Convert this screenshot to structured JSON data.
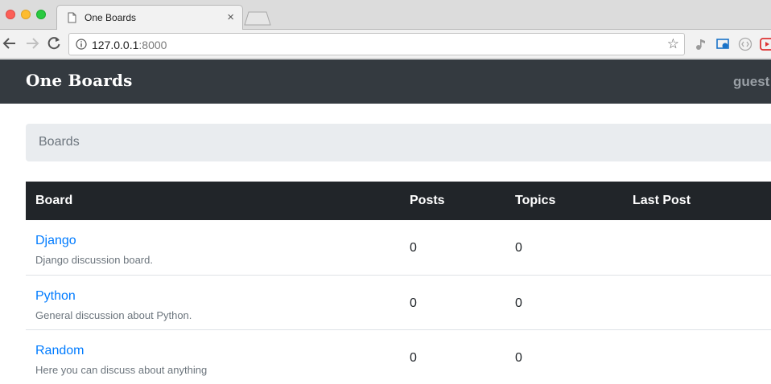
{
  "browser": {
    "tab_title": "One Boards",
    "tab_close": "×",
    "url_host": "127.0.0.1",
    "url_port": ":8000",
    "bookmark_star": "☆"
  },
  "navbar": {
    "brand": "One Boards",
    "user": "guest"
  },
  "breadcrumb": {
    "current": "Boards"
  },
  "table": {
    "headers": [
      "Board",
      "Posts",
      "Topics",
      "Last Post"
    ],
    "rows": [
      {
        "name": "Django",
        "description": "Django discussion board.",
        "posts": "0",
        "topics": "0"
      },
      {
        "name": "Python",
        "description": "General discussion about Python.",
        "posts": "0",
        "topics": "0"
      },
      {
        "name": "Random",
        "description": "Here you can discuss about anything",
        "posts": "0",
        "topics": "0"
      }
    ]
  },
  "colors": {
    "navbar": "#343a40",
    "table_head": "#212529",
    "link": "#007bff",
    "muted": "#6c757d"
  }
}
